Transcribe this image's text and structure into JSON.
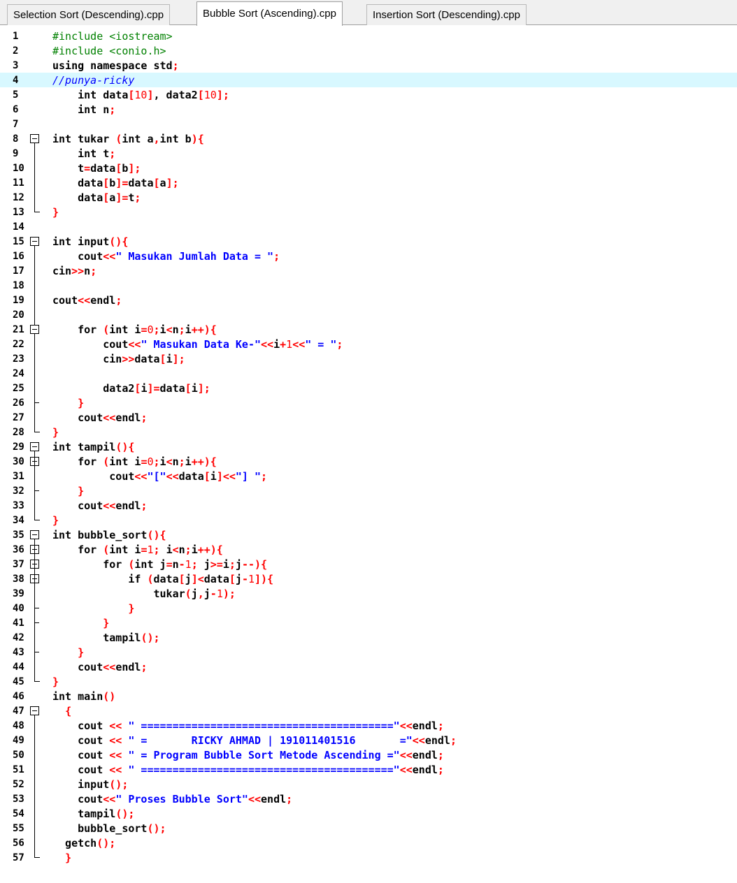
{
  "tabs": [
    {
      "label": "Selection Sort (Descending).cpp",
      "active": false
    },
    {
      "label": "Bubble Sort (Ascending).cpp",
      "active": true
    },
    {
      "label": "Insertion Sort (Descending).cpp",
      "active": false
    }
  ],
  "highlighted_line": 4,
  "colors": {
    "preprocessor": "#008000",
    "comment": "#0000ff",
    "string": "#0000ff",
    "number": "#ff0000",
    "symbol": "#ff0000",
    "keyword": "#000000",
    "highlight": "#d8f8ff"
  },
  "lines": [
    {
      "n": "1",
      "t": [
        [
          "pp",
          "#include <iostream>"
        ]
      ]
    },
    {
      "n": "2",
      "t": [
        [
          "pp",
          "#include <conio.h>"
        ]
      ]
    },
    {
      "n": "3",
      "t": [
        [
          "k",
          "using namespace "
        ],
        [
          "t",
          "std"
        ],
        [
          "sym",
          ";"
        ]
      ]
    },
    {
      "n": "4",
      "t": [
        [
          "cm",
          "//punya-ricky"
        ]
      ]
    },
    {
      "n": "5",
      "t": [
        [
          "t",
          "    "
        ],
        [
          "k",
          "int "
        ],
        [
          "t",
          "data"
        ],
        [
          "sym",
          "["
        ],
        [
          "n",
          "10"
        ],
        [
          "sym",
          "]"
        ],
        [
          "t",
          ", data2"
        ],
        [
          "sym",
          "["
        ],
        [
          "n",
          "10"
        ],
        [
          "sym",
          "];"
        ]
      ]
    },
    {
      "n": "6",
      "t": [
        [
          "t",
          "    "
        ],
        [
          "k",
          "int "
        ],
        [
          "t",
          "n"
        ],
        [
          "sym",
          ";"
        ]
      ]
    },
    {
      "n": "7",
      "t": []
    },
    {
      "n": "8",
      "t": [
        [
          "k",
          "int "
        ],
        [
          "t",
          "tukar "
        ],
        [
          "sym",
          "("
        ],
        [
          "k",
          "int "
        ],
        [
          "t",
          "a"
        ],
        [
          "sym",
          ","
        ],
        [
          "k",
          "int "
        ],
        [
          "t",
          "b"
        ],
        [
          "sym",
          "){"
        ]
      ]
    },
    {
      "n": "9",
      "t": [
        [
          "t",
          "    "
        ],
        [
          "k",
          "int "
        ],
        [
          "t",
          "t"
        ],
        [
          "sym",
          ";"
        ]
      ]
    },
    {
      "n": "10",
      "t": [
        [
          "t",
          "    t"
        ],
        [
          "sym",
          "="
        ],
        [
          "t",
          "data"
        ],
        [
          "sym",
          "["
        ],
        [
          "t",
          "b"
        ],
        [
          "sym",
          "];"
        ]
      ]
    },
    {
      "n": "11",
      "t": [
        [
          "t",
          "    data"
        ],
        [
          "sym",
          "["
        ],
        [
          "t",
          "b"
        ],
        [
          "sym",
          "]="
        ],
        [
          "t",
          "data"
        ],
        [
          "sym",
          "["
        ],
        [
          "t",
          "a"
        ],
        [
          "sym",
          "];"
        ]
      ]
    },
    {
      "n": "12",
      "t": [
        [
          "t",
          "    data"
        ],
        [
          "sym",
          "["
        ],
        [
          "t",
          "a"
        ],
        [
          "sym",
          "]="
        ],
        [
          "t",
          "t"
        ],
        [
          "sym",
          ";"
        ]
      ]
    },
    {
      "n": "13",
      "t": [
        [
          "sym",
          "}"
        ]
      ]
    },
    {
      "n": "14",
      "t": []
    },
    {
      "n": "15",
      "t": [
        [
          "k",
          "int "
        ],
        [
          "t",
          "input"
        ],
        [
          "sym",
          "(){"
        ]
      ]
    },
    {
      "n": "16",
      "t": [
        [
          "t",
          "    cout"
        ],
        [
          "sym",
          "<<"
        ],
        [
          "s",
          "\" Masukan Jumlah Data = \""
        ],
        [
          "sym",
          ";"
        ]
      ]
    },
    {
      "n": "17",
      "t": [
        [
          "t",
          "cin"
        ],
        [
          "sym",
          ">>"
        ],
        [
          "t",
          "n"
        ],
        [
          "sym",
          ";"
        ]
      ]
    },
    {
      "n": "18",
      "t": []
    },
    {
      "n": "19",
      "t": [
        [
          "t",
          "cout"
        ],
        [
          "sym",
          "<<"
        ],
        [
          "t",
          "endl"
        ],
        [
          "sym",
          ";"
        ]
      ]
    },
    {
      "n": "20",
      "t": []
    },
    {
      "n": "21",
      "t": [
        [
          "t",
          "    "
        ],
        [
          "k",
          "for "
        ],
        [
          "sym",
          "("
        ],
        [
          "k",
          "int "
        ],
        [
          "t",
          "i"
        ],
        [
          "sym",
          "="
        ],
        [
          "n",
          "0"
        ],
        [
          "sym",
          ";"
        ],
        [
          "t",
          "i"
        ],
        [
          "sym",
          "<"
        ],
        [
          "t",
          "n"
        ],
        [
          "sym",
          ";"
        ],
        [
          "t",
          "i"
        ],
        [
          "sym",
          "++){"
        ]
      ]
    },
    {
      "n": "22",
      "t": [
        [
          "t",
          "        cout"
        ],
        [
          "sym",
          "<<"
        ],
        [
          "s",
          "\" Masukan Data Ke-\""
        ],
        [
          "sym",
          "<<"
        ],
        [
          "t",
          "i"
        ],
        [
          "sym",
          "+"
        ],
        [
          "n",
          "1"
        ],
        [
          "sym",
          "<<"
        ],
        [
          "s",
          "\" = \""
        ],
        [
          "sym",
          ";"
        ]
      ]
    },
    {
      "n": "23",
      "t": [
        [
          "t",
          "        cin"
        ],
        [
          "sym",
          ">>"
        ],
        [
          "t",
          "data"
        ],
        [
          "sym",
          "["
        ],
        [
          "t",
          "i"
        ],
        [
          "sym",
          "];"
        ]
      ]
    },
    {
      "n": "24",
      "t": []
    },
    {
      "n": "25",
      "t": [
        [
          "t",
          "        data2"
        ],
        [
          "sym",
          "["
        ],
        [
          "t",
          "i"
        ],
        [
          "sym",
          "]="
        ],
        [
          "t",
          "data"
        ],
        [
          "sym",
          "["
        ],
        [
          "t",
          "i"
        ],
        [
          "sym",
          "];"
        ]
      ]
    },
    {
      "n": "26",
      "t": [
        [
          "t",
          "    "
        ],
        [
          "sym",
          "}"
        ]
      ]
    },
    {
      "n": "27",
      "t": [
        [
          "t",
          "    cout"
        ],
        [
          "sym",
          "<<"
        ],
        [
          "t",
          "endl"
        ],
        [
          "sym",
          ";"
        ]
      ]
    },
    {
      "n": "28",
      "t": [
        [
          "sym",
          "}"
        ]
      ]
    },
    {
      "n": "29",
      "t": [
        [
          "k",
          "int "
        ],
        [
          "t",
          "tampil"
        ],
        [
          "sym",
          "(){"
        ]
      ]
    },
    {
      "n": "30",
      "t": [
        [
          "t",
          "    "
        ],
        [
          "k",
          "for "
        ],
        [
          "sym",
          "("
        ],
        [
          "k",
          "int "
        ],
        [
          "t",
          "i"
        ],
        [
          "sym",
          "="
        ],
        [
          "n",
          "0"
        ],
        [
          "sym",
          ";"
        ],
        [
          "t",
          "i"
        ],
        [
          "sym",
          "<"
        ],
        [
          "t",
          "n"
        ],
        [
          "sym",
          ";"
        ],
        [
          "t",
          "i"
        ],
        [
          "sym",
          "++){"
        ]
      ]
    },
    {
      "n": "31",
      "t": [
        [
          "t",
          "         cout"
        ],
        [
          "sym",
          "<<"
        ],
        [
          "s",
          "\"[\""
        ],
        [
          "sym",
          "<<"
        ],
        [
          "t",
          "data"
        ],
        [
          "sym",
          "["
        ],
        [
          "t",
          "i"
        ],
        [
          "sym",
          "]<<"
        ],
        [
          "s",
          "\"] \""
        ],
        [
          "sym",
          ";"
        ]
      ]
    },
    {
      "n": "32",
      "t": [
        [
          "t",
          "    "
        ],
        [
          "sym",
          "}"
        ]
      ]
    },
    {
      "n": "33",
      "t": [
        [
          "t",
          "    cout"
        ],
        [
          "sym",
          "<<"
        ],
        [
          "t",
          "endl"
        ],
        [
          "sym",
          ";"
        ]
      ]
    },
    {
      "n": "34",
      "t": [
        [
          "sym",
          "}"
        ]
      ]
    },
    {
      "n": "35",
      "t": [
        [
          "k",
          "int "
        ],
        [
          "t",
          "bubble_sort"
        ],
        [
          "sym",
          "(){"
        ]
      ]
    },
    {
      "n": "36",
      "t": [
        [
          "t",
          "    "
        ],
        [
          "k",
          "for "
        ],
        [
          "sym",
          "("
        ],
        [
          "k",
          "int "
        ],
        [
          "t",
          "i"
        ],
        [
          "sym",
          "="
        ],
        [
          "n",
          "1"
        ],
        [
          "sym",
          "; "
        ],
        [
          "t",
          "i"
        ],
        [
          "sym",
          "<"
        ],
        [
          "t",
          "n"
        ],
        [
          "sym",
          ";"
        ],
        [
          "t",
          "i"
        ],
        [
          "sym",
          "++){"
        ]
      ]
    },
    {
      "n": "37",
      "t": [
        [
          "t",
          "        "
        ],
        [
          "k",
          "for "
        ],
        [
          "sym",
          "("
        ],
        [
          "k",
          "int "
        ],
        [
          "t",
          "j"
        ],
        [
          "sym",
          "="
        ],
        [
          "t",
          "n"
        ],
        [
          "sym",
          "-"
        ],
        [
          "n",
          "1"
        ],
        [
          "sym",
          "; "
        ],
        [
          "t",
          "j"
        ],
        [
          "sym",
          ">="
        ],
        [
          "t",
          "i"
        ],
        [
          "sym",
          ";"
        ],
        [
          "t",
          "j"
        ],
        [
          "sym",
          "--){"
        ]
      ]
    },
    {
      "n": "38",
      "t": [
        [
          "t",
          "            "
        ],
        [
          "k",
          "if "
        ],
        [
          "sym",
          "("
        ],
        [
          "t",
          "data"
        ],
        [
          "sym",
          "["
        ],
        [
          "t",
          "j"
        ],
        [
          "sym",
          "]<"
        ],
        [
          "t",
          "data"
        ],
        [
          "sym",
          "["
        ],
        [
          "t",
          "j"
        ],
        [
          "sym",
          "-"
        ],
        [
          "n",
          "1"
        ],
        [
          "sym",
          "]){"
        ]
      ]
    },
    {
      "n": "39",
      "t": [
        [
          "t",
          "                tukar"
        ],
        [
          "sym",
          "("
        ],
        [
          "t",
          "j"
        ],
        [
          "sym",
          ","
        ],
        [
          "t",
          "j"
        ],
        [
          "sym",
          "-"
        ],
        [
          "n",
          "1"
        ],
        [
          "sym",
          ");"
        ]
      ]
    },
    {
      "n": "40",
      "t": [
        [
          "t",
          "            "
        ],
        [
          "sym",
          "}"
        ]
      ]
    },
    {
      "n": "41",
      "t": [
        [
          "t",
          "        "
        ],
        [
          "sym",
          "}"
        ]
      ]
    },
    {
      "n": "42",
      "t": [
        [
          "t",
          "        tampil"
        ],
        [
          "sym",
          "();"
        ]
      ]
    },
    {
      "n": "43",
      "t": [
        [
          "t",
          "    "
        ],
        [
          "sym",
          "}"
        ]
      ]
    },
    {
      "n": "44",
      "t": [
        [
          "t",
          "    cout"
        ],
        [
          "sym",
          "<<"
        ],
        [
          "t",
          "endl"
        ],
        [
          "sym",
          ";"
        ]
      ]
    },
    {
      "n": "45",
      "t": [
        [
          "sym",
          "}"
        ]
      ]
    },
    {
      "n": "46",
      "t": [
        [
          "k",
          "int "
        ],
        [
          "t",
          "main"
        ],
        [
          "sym",
          "()"
        ]
      ]
    },
    {
      "n": "47",
      "t": [
        [
          "t",
          "  "
        ],
        [
          "sym",
          "{"
        ]
      ]
    },
    {
      "n": "48",
      "t": [
        [
          "t",
          "    cout "
        ],
        [
          "sym",
          "<< "
        ],
        [
          "s",
          "\" ========================================\""
        ],
        [
          "sym",
          "<<"
        ],
        [
          "t",
          "endl"
        ],
        [
          "sym",
          ";"
        ]
      ]
    },
    {
      "n": "49",
      "t": [
        [
          "t",
          "    cout "
        ],
        [
          "sym",
          "<< "
        ],
        [
          "s",
          "\" =       RICKY AHMAD | 191011401516       =\""
        ],
        [
          "sym",
          "<<"
        ],
        [
          "t",
          "endl"
        ],
        [
          "sym",
          ";"
        ]
      ]
    },
    {
      "n": "50",
      "t": [
        [
          "t",
          "    cout "
        ],
        [
          "sym",
          "<< "
        ],
        [
          "s",
          "\" = Program Bubble Sort Metode Ascending =\""
        ],
        [
          "sym",
          "<<"
        ],
        [
          "t",
          "endl"
        ],
        [
          "sym",
          ";"
        ]
      ]
    },
    {
      "n": "51",
      "t": [
        [
          "t",
          "    cout "
        ],
        [
          "sym",
          "<< "
        ],
        [
          "s",
          "\" ========================================\""
        ],
        [
          "sym",
          "<<"
        ],
        [
          "t",
          "endl"
        ],
        [
          "sym",
          ";"
        ]
      ]
    },
    {
      "n": "52",
      "t": [
        [
          "t",
          "    input"
        ],
        [
          "sym",
          "();"
        ]
      ]
    },
    {
      "n": "53",
      "t": [
        [
          "t",
          "    cout"
        ],
        [
          "sym",
          "<<"
        ],
        [
          "s",
          "\" Proses Bubble Sort\""
        ],
        [
          "sym",
          "<<"
        ],
        [
          "t",
          "endl"
        ],
        [
          "sym",
          ";"
        ]
      ]
    },
    {
      "n": "54",
      "t": [
        [
          "t",
          "    tampil"
        ],
        [
          "sym",
          "();"
        ]
      ]
    },
    {
      "n": "55",
      "t": [
        [
          "t",
          "    bubble_sort"
        ],
        [
          "sym",
          "();"
        ]
      ]
    },
    {
      "n": "56",
      "t": [
        [
          "t",
          "  getch"
        ],
        [
          "sym",
          "();"
        ]
      ]
    },
    {
      "n": "57",
      "t": [
        [
          "t",
          "  "
        ],
        [
          "sym",
          "}"
        ]
      ]
    }
  ]
}
